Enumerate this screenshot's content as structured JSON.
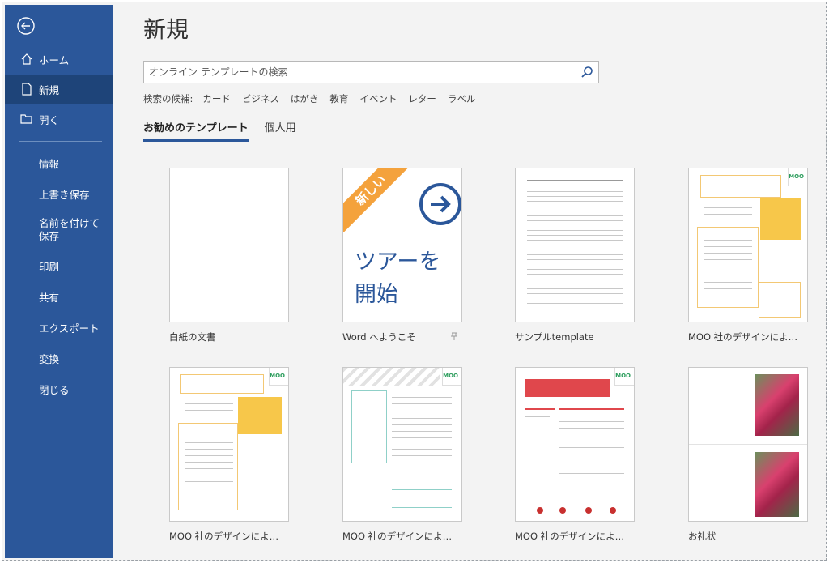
{
  "sidebar": {
    "back_icon": "back-arrow-icon",
    "items": [
      {
        "label": "ホーム",
        "icon": "home-icon"
      },
      {
        "label": "新規",
        "icon": "new-document-icon"
      },
      {
        "label": "開く",
        "icon": "open-folder-icon"
      },
      {
        "label": "情報"
      },
      {
        "label": "上書き保存"
      },
      {
        "label": "名前を付けて保存"
      },
      {
        "label": "印刷"
      },
      {
        "label": "共有"
      },
      {
        "label": "エクスポート"
      },
      {
        "label": "変換"
      },
      {
        "label": "閉じる"
      }
    ]
  },
  "main": {
    "title": "新規",
    "search": {
      "placeholder": "オンライン テンプレートの検索"
    },
    "suggestions_label": "検索の候補:",
    "suggestions": [
      "カード",
      "ビジネス",
      "はがき",
      "教育",
      "イベント",
      "レター",
      "ラベル"
    ],
    "tabs": [
      "お勧めのテンプレート",
      "個人用"
    ],
    "templates": [
      {
        "label": "白紙の文書"
      },
      {
        "label": "Word へようこそ",
        "badge": "新しい",
        "thumb_text": "ツアーを開始"
      },
      {
        "label": "サンプルtemplate"
      },
      {
        "label": "MOO 社のデザインによ…"
      },
      {
        "label": "MOO 社のデザインによ…"
      },
      {
        "label": "MOO 社のデザインによ…"
      },
      {
        "label": "MOO 社のデザインによ…"
      },
      {
        "label": "お礼状"
      }
    ],
    "moo_logo": "MOO"
  },
  "colors": {
    "accent": "#2b579a",
    "sidebar_active": "#1e4479",
    "ribbon": "#f4a23c"
  }
}
